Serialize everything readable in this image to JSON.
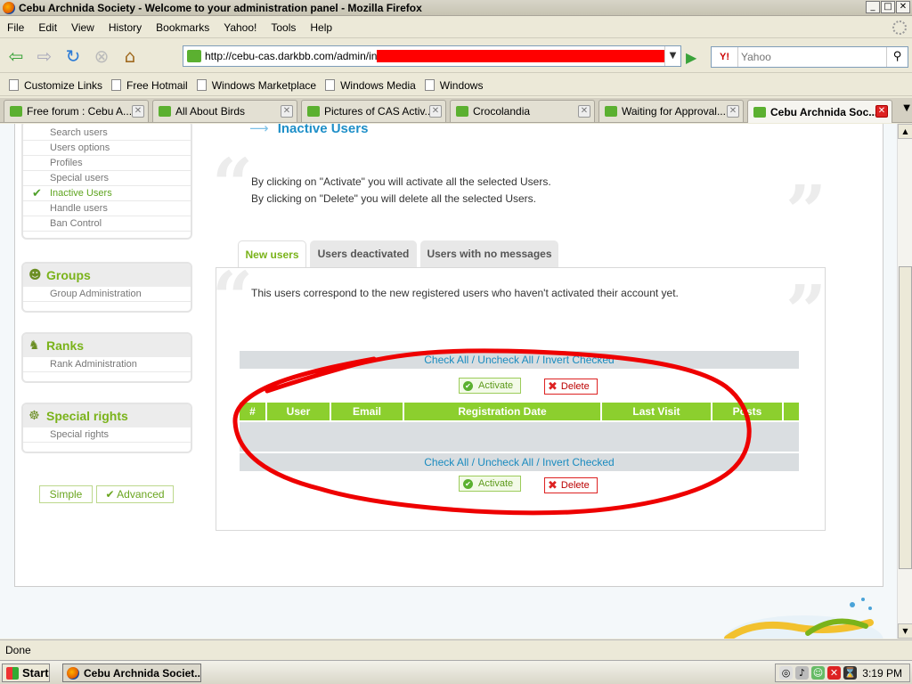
{
  "window": {
    "title": "Cebu Archnida Society - Welcome to your administration panel - Mozilla Firefox",
    "min": "_",
    "max": "□",
    "close": "✕"
  },
  "menu": {
    "items": [
      {
        "label": "File"
      },
      {
        "label": "Edit"
      },
      {
        "label": "View"
      },
      {
        "label": "History"
      },
      {
        "label": "Bookmarks"
      },
      {
        "label": "Yahoo!"
      },
      {
        "label": "Tools"
      },
      {
        "label": "Help"
      }
    ]
  },
  "nav": {
    "url": "http://cebu-cas.darkbb.com/admin/inde",
    "search_engine": "Y!",
    "search_placeholder": "Yahoo"
  },
  "bookmarks": [
    {
      "label": "Customize Links"
    },
    {
      "label": "Free Hotmail"
    },
    {
      "label": "Windows Marketplace"
    },
    {
      "label": "Windows Media"
    },
    {
      "label": "Windows"
    }
  ],
  "tabs": [
    {
      "label": "Free forum : Cebu A..."
    },
    {
      "label": "All About Birds"
    },
    {
      "label": "Pictures of CAS Activ..."
    },
    {
      "label": "Crocolandia"
    },
    {
      "label": "Waiting for Approval..."
    },
    {
      "label": "Cebu Archnida Soc..."
    }
  ],
  "sidebar": {
    "users_links": [
      {
        "label": "Search users"
      },
      {
        "label": "Users options"
      },
      {
        "label": "Profiles"
      },
      {
        "label": "Special users"
      },
      {
        "label": "Inactive Users"
      },
      {
        "label": "Handle users"
      },
      {
        "label": "Ban Control"
      }
    ],
    "groups": {
      "title": "Groups",
      "link": "Group Administration"
    },
    "ranks": {
      "title": "Ranks",
      "link": "Rank Administration"
    },
    "special": {
      "title": "Special rights",
      "link": "Special rights"
    },
    "mode_simple": "Simple",
    "mode_advanced": "Advanced"
  },
  "main": {
    "title": "Inactive Users",
    "intro_line1": "By clicking on \"Activate\" you will activate all the selected Users.",
    "intro_line2": "By clicking on \"Delete\" you will delete all the selected Users.",
    "subtabs": [
      {
        "label": "New users"
      },
      {
        "label": "Users deactivated"
      },
      {
        "label": "Users with no messages"
      }
    ],
    "panel_text": "This users correspond to the new registered users who haven't activated their account yet.",
    "check_all": "Check All",
    "uncheck_all": "Uncheck All",
    "invert_checked": "Invert Checked",
    "sep": " / ",
    "activate_label": "Activate",
    "delete_label": "Delete",
    "columns": [
      "#",
      "User",
      "Email",
      "Registration Date",
      "Last Visit",
      "Posts"
    ]
  },
  "status": {
    "text": "Done"
  },
  "taskbar": {
    "start": "Start",
    "task": "Cebu Archnida Societ...",
    "clock": "3:19 PM"
  },
  "annotation_color": "#ee0000"
}
